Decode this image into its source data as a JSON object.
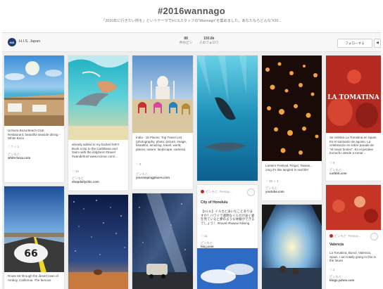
{
  "page": {
    "title": "#2016wannago",
    "subtitle": "「2016年に行きたい所を」というテーマでH.I.Sスタッフの\"Wannago\"を集めました。あなたならどんな\"#20..."
  },
  "board_header": {
    "logo_text": "HIS",
    "company": "H.I.S. Japan",
    "stats": [
      {
        "value": "88",
        "label": "件のピン"
      },
      {
        "value": "150.8k",
        "label": "人のフォロワ"
      }
    ],
    "follow_label": "フォローする",
    "share_label": "◀"
  },
  "pins": {
    "p1": {
      "desc": "Uchiura Boza Beach Club Restaurant, beautiful seaside dining - White Boza",
      "meta": "♡ 7  ☆ 1",
      "via_label": "ピンもと:",
      "via_source": "white-boza.com"
    },
    "p2": {
      "desc": "already added to my bucket list!!!! Book a trip to the Caribbean and Swim with the dolphins! #travel #wanderlust www.ecinnic.com/...",
      "meta": "♡ 10",
      "via_label": "ピンもと:",
      "via_source": "shopdailychic.com"
    },
    "p3": {
      "desc": "India - 15 Places: Top Travel List (photography, photo, picture, image, beautiful, amazing, travel, world, places, nature, landscape, camera)",
      "meta": "♡ 9",
      "via_label": "ピンもと:",
      "via_source": "yourampingplaces.com"
    },
    "p4": {
      "source": "ピンもと: Fennay...",
      "heading": "City of Honolulu",
      "desc": "【H.I.S.】イルカと泳いだことありますか？ハワイで透明なイルカが泳ぐ姿を見ていると夢のような体験ができるでしょう！ #travel #hawaii #diving",
      "meta": "♡ 11",
      "via_label": "ピンもと:",
      "via_source": "his.j.com"
    },
    "p5": {
      "desc": "Lantern Festival, Pingxi, Taiwan... omg it's like tangled in real life!",
      "meta": "♡ 18  ☆ 1",
      "via_label": "ピンもと:",
      "via_source": "youtube.com"
    },
    "p6": {
      "overlay": "LA TOMATINA",
      "desc": "Se celebra La Tomatina en Spain. Es el santuario de agosto. La celebración es sobre parade de \"el mejor tiroteo\". En el peralee borracho desde a tomar...",
      "meta": "♡ 9",
      "via_label": "ピンもと:",
      "via_source": "curbbit.com"
    },
    "p7": {
      "sign": "66",
      "desc": "Route 66 through the desert town of Amboy, California. The famous"
    },
    "p10": {
      "source": "ピンもと: Fennay...",
      "heading": "Valencia",
      "desc": "La Tomatina, Bunol, Valencia, Spain. I am totally going to this in the future",
      "meta": "♡ 2",
      "via_label": "ピンもと:",
      "via_source": "blogs.yahoo.com"
    }
  }
}
